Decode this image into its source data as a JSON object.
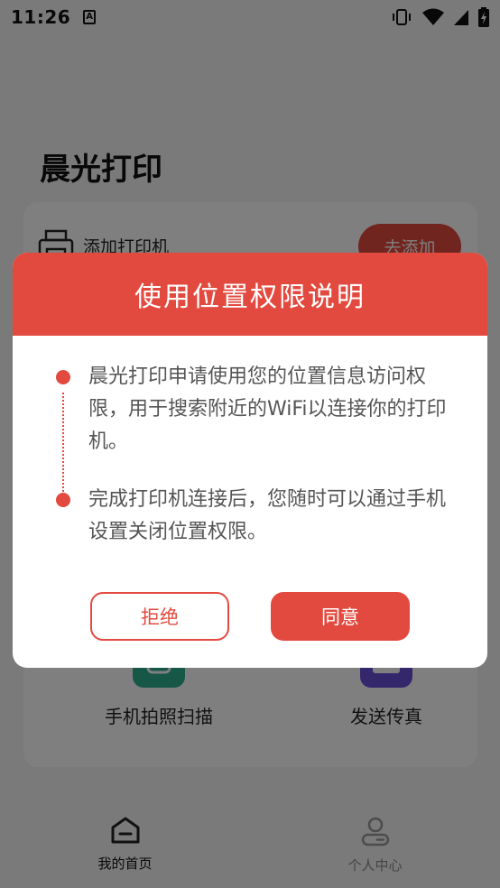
{
  "status_bar": {
    "time": "11:26",
    "notification_icon_letter": "A",
    "icons": [
      "vibrate-icon",
      "wifi-icon",
      "signal-icon",
      "battery-charging-icon"
    ]
  },
  "app": {
    "title": "晨光打印",
    "printer_row": {
      "label": "添加打印机",
      "button": "去添加"
    },
    "features": [
      {
        "label": "手机拍照扫描",
        "icon": "camera-scan-icon"
      },
      {
        "label": "发送传真",
        "icon": "fax-icon"
      }
    ],
    "bottom_nav": [
      {
        "label": "我的首页",
        "icon": "home-icon",
        "active": true
      },
      {
        "label": "个人中心",
        "icon": "person-icon",
        "active": false
      }
    ]
  },
  "dialog": {
    "title": "使用位置权限说明",
    "items": [
      "晨光打印申请使用您的位置信息访问权限，用于搜索附近的WiFi以连接你的打印机。",
      "完成打印机连接后，您随时可以通过手机设置关闭位置权限。"
    ],
    "refuse_label": "拒绝",
    "agree_label": "同意"
  },
  "colors": {
    "accent": "#e34a3f",
    "overlay": "rgba(0,0,0,0.5)",
    "scan_icon_bg": "#2fae91",
    "fax_icon_bg": "#6b4fd8"
  }
}
